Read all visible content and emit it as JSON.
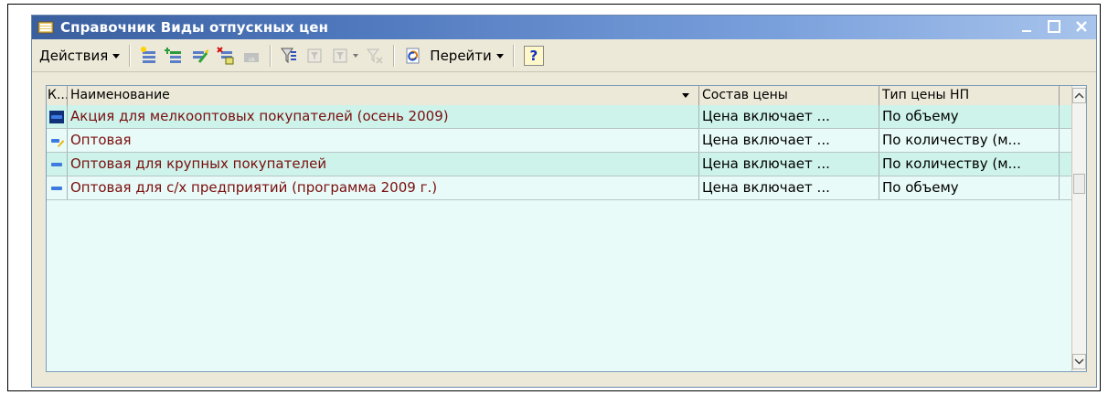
{
  "window": {
    "title": "Справочник Виды отпускных цен",
    "controls": {
      "minimize": "_",
      "maximize": "□",
      "close": "×"
    }
  },
  "toolbar": {
    "actions_label": "Действия",
    "goto_label": "Перейти",
    "help_label": "?",
    "buttons": [
      "add-icon",
      "add-group-icon",
      "copy-icon",
      "mark-delete-icon",
      "barcode-icon",
      "filter-icon",
      "filter-value-icon",
      "filter-history-icon",
      "clear-filter-icon",
      "refresh-icon"
    ]
  },
  "table": {
    "columns": [
      "К...",
      "Наименование",
      "Состав цены",
      "Тип цены НП"
    ],
    "rows": [
      {
        "name": "Акция для мелкооптовых покупателей (осень 2009)",
        "price_composition": "Цена включает ...",
        "price_type": "По объему",
        "icon": "element-icon"
      },
      {
        "name": "Оптовая",
        "price_composition": "Цена включает ...",
        "price_type": "По количеству (м...",
        "icon": "element-edit-icon"
      },
      {
        "name": "Оптовая для крупных покупателей",
        "price_composition": "Цена включает ...",
        "price_type": "По количеству (м...",
        "icon": "element-icon"
      },
      {
        "name": "Оптовая для с/х предприятий (программа 2009 г.)",
        "price_composition": "Цена включает ...",
        "price_type": "По объему",
        "icon": "element-icon"
      }
    ]
  },
  "colors": {
    "title_bar_start": "#3a5f9e",
    "row_alt": "#cdf3ea",
    "row_base": "#e8fbf8",
    "name_text": "#7b0e0e"
  }
}
